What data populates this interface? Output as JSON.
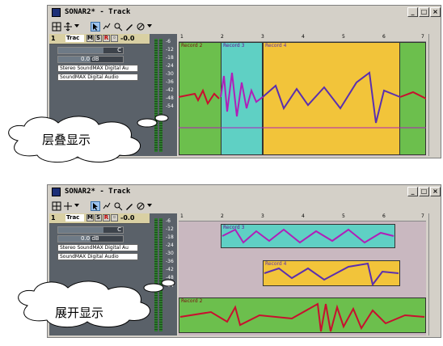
{
  "windows": [
    {
      "id": "layered",
      "title": "SONAR2* - Track",
      "track": {
        "number": "1",
        "name": "Trac",
        "buttons": [
          "M",
          "S",
          "R"
        ],
        "volume_db": "-0.0",
        "pan_readout": "0.0 dB",
        "pan_center": "C",
        "input": "Stereo SoundMAX Digital Au",
        "output": "SoundMAX Digital Audio"
      },
      "ruler_ticks": [
        "1",
        "2",
        "3",
        "4",
        "5",
        "6",
        "7"
      ],
      "meter_scale": [
        "-6",
        "-12",
        "-18",
        "-24",
        "-30",
        "-36",
        "-42",
        "-48",
        "-54"
      ],
      "clips": [
        {
          "label": "Record 2",
          "color": "#6cbf4d",
          "wave": "#c8102e"
        },
        {
          "label": "Record 3",
          "color": "#5fd0c4",
          "wave": "#b01fb8"
        },
        {
          "label": "Record 4",
          "color": "#f2c43a",
          "wave": "#5a2fb0"
        }
      ],
      "callout": "层叠显示"
    },
    {
      "id": "expanded",
      "title": "SONAR2* - Track",
      "track": {
        "number": "1",
        "name": "Trac",
        "buttons": [
          "M",
          "S",
          "R"
        ],
        "volume_db": "-0.0",
        "pan_readout": "0.0 dB",
        "pan_center": "C",
        "input": "Stereo SoundMAX Digital Au",
        "output": "SoundMAX Digital Audio"
      },
      "ruler_ticks": [
        "1",
        "2",
        "3",
        "4",
        "5",
        "6",
        "7"
      ],
      "meter_scale": [
        "-6",
        "-12",
        "-18",
        "-24",
        "-30",
        "-36",
        "-42",
        "-48",
        "-54"
      ],
      "clips": [
        {
          "label": "Record 3",
          "color": "#5fd0c4",
          "wave": "#b01fb8"
        },
        {
          "label": "Record 4",
          "color": "#f2c43a",
          "wave": "#5a2fb0"
        },
        {
          "label": "Record 2",
          "color": "#6cbf4d",
          "wave": "#c8102e"
        }
      ],
      "callout": "展开显示"
    }
  ]
}
